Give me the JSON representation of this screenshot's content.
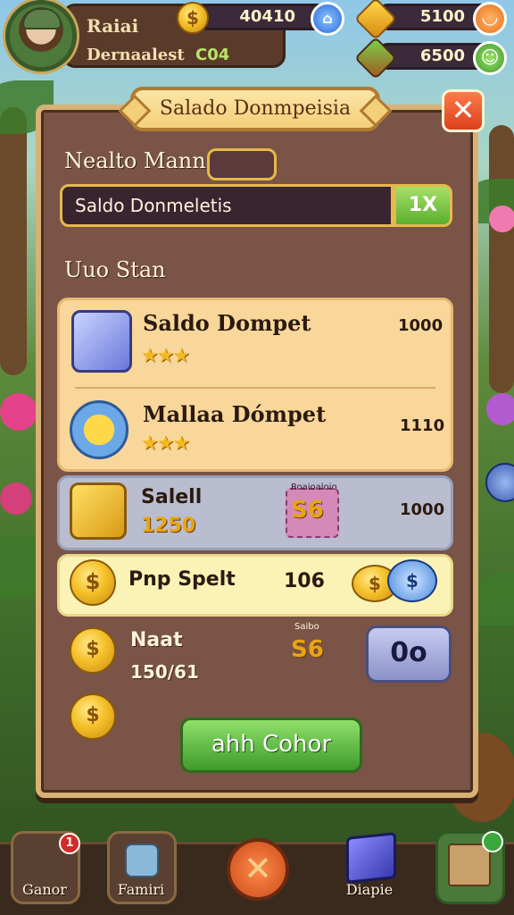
{
  "hud": {
    "player_name": "Raiai",
    "sub_label": "Dernaalest",
    "sub_value": "C04",
    "coins": "40410",
    "gems": "5100",
    "energy": "6500"
  },
  "panel": {
    "title": "Salado Donmpeisia",
    "close_label": "✕",
    "name_label": "Nealto Mann",
    "search_value": "Saldo Donmeletis",
    "search_button": "1X",
    "section_label": "Uuo Stan"
  },
  "items": [
    {
      "name": "Saldo Dompet",
      "value": "1000",
      "stars": "★★★"
    },
    {
      "name": "Mallaa Dómpet",
      "value": "1110",
      "stars": "★★★"
    }
  ],
  "row_gold": {
    "name": "Salell",
    "amount": "1250",
    "badge_label": "Roaioaloio",
    "badge_value": "S6",
    "value": "1000"
  },
  "row_spet": {
    "name": "Pnp Spelt",
    "value": "106"
  },
  "row_naat": {
    "name": "Naat",
    "amount": "150/61",
    "badge_label": "Saibo",
    "badge_value": "S6",
    "button": "0o"
  },
  "collect_button": "ahh Cohor",
  "nav": [
    {
      "label": "Ganor",
      "badge": "1"
    },
    {
      "label": "Famiri"
    },
    {
      "label": ""
    },
    {
      "label": "Diapie"
    },
    {
      "label": ""
    }
  ],
  "colors": {
    "panel": "#7a5446",
    "accent_green": "#5cae2e",
    "gold": "#f5c02a",
    "close_red": "#d9401c"
  }
}
